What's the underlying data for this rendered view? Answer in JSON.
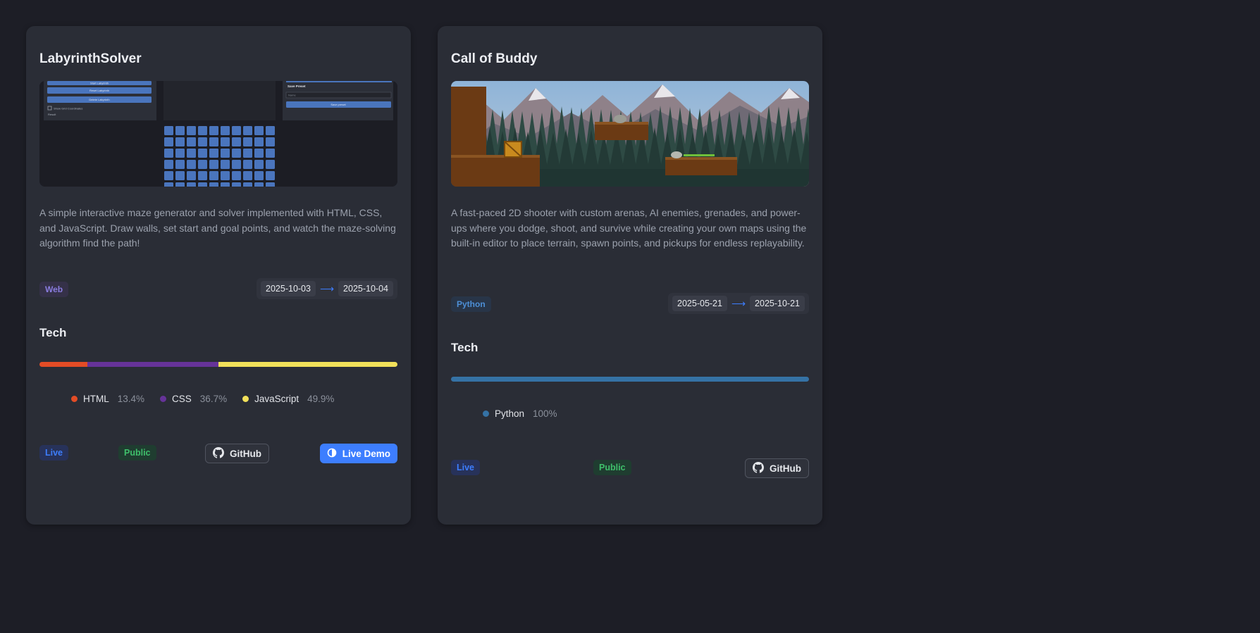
{
  "colors": {
    "background": "#1d1e26",
    "card": "#2a2d36",
    "accent": "#3d7eff",
    "html": "#e34c26",
    "css": "#663399",
    "javascript": "#f1e05a",
    "python": "#3572a5"
  },
  "projects": [
    {
      "title": "LabyrinthSolver",
      "description": "A simple interactive maze generator and solver implemented with HTML, CSS, and JavaScript. Draw walls, set start and goal points, and watch the maze-solving algorithm find the path!",
      "category": "Web",
      "start_date": "2025-10-03",
      "end_date": "2025-10-04",
      "tech_heading": "Tech",
      "languages": [
        {
          "name": "HTML",
          "percent": "13.4%",
          "share": 13.4,
          "color": "#e34c26"
        },
        {
          "name": "CSS",
          "percent": "36.7%",
          "share": 36.7,
          "color": "#663399"
        },
        {
          "name": "JavaScript",
          "percent": "49.9%",
          "share": 49.9,
          "color": "#f1e05a"
        }
      ],
      "status": "Live",
      "visibility": "Public",
      "github_label": "GitHub",
      "demo_label": "Live Demo",
      "github_icon": "github-icon",
      "demo_icon": "globe-icon",
      "screenshot": {
        "buttons": [
          "Start Labyrinth",
          "Reset Labyrinth",
          "Delete Labyrinth"
        ],
        "checkbox_label": "Show Grid Coordinates",
        "footer_text": "Result",
        "preset_title": "Save Preset",
        "preset_placeholder": "Name",
        "preset_button": "Save preset"
      }
    },
    {
      "title": "Call of Buddy",
      "description": "A fast-paced 2D shooter with custom arenas, AI enemies, grenades, and power-ups where you dodge, shoot, and survive while creating your own maps using the built-in editor to place terrain, spawn points, and pickups for endless replayability.",
      "category": "Python",
      "start_date": "2025-05-21",
      "end_date": "2025-10-21",
      "tech_heading": "Tech",
      "languages": [
        {
          "name": "Python",
          "percent": "100%",
          "share": 100,
          "color": "#3572a5"
        }
      ],
      "status": "Live",
      "visibility": "Public",
      "github_label": "GitHub",
      "github_icon": "github-icon"
    }
  ]
}
